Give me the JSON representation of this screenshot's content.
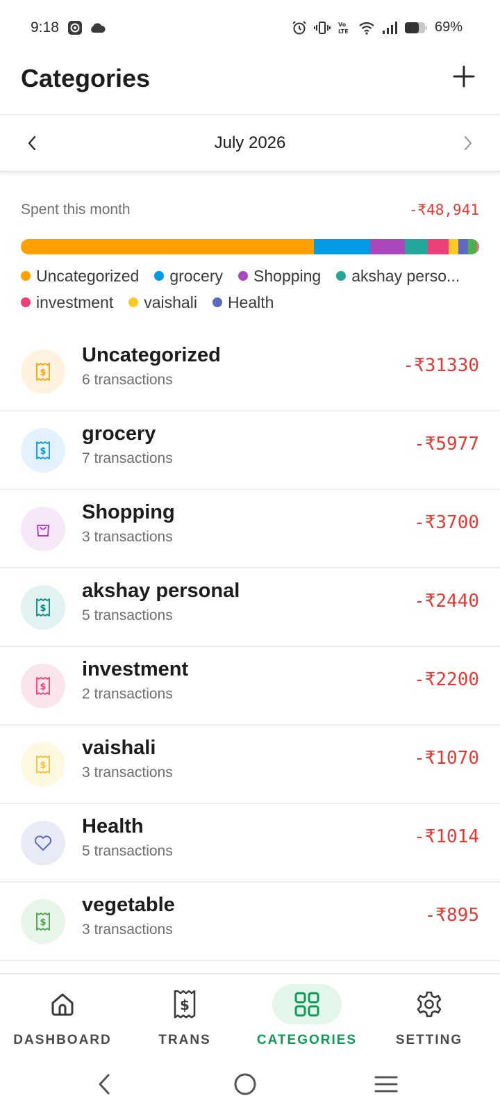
{
  "status_bar": {
    "time": "9:18",
    "battery": "69%"
  },
  "header": {
    "title": "Categories"
  },
  "month_nav": {
    "label": "July 2026"
  },
  "summary": {
    "label": "Spent this month",
    "total": "-₹48,941",
    "segments": [
      {
        "category": "Uncategorized",
        "share": 0.64,
        "color": "#FFA000"
      },
      {
        "category": "grocery",
        "share": 0.122,
        "color": "#039BE5"
      },
      {
        "category": "Shopping",
        "share": 0.076,
        "color": "#AB47BC"
      },
      {
        "category": "akshay personal",
        "share": 0.05,
        "color": "#26A69A"
      },
      {
        "category": "investment",
        "share": 0.045,
        "color": "#EC407A"
      },
      {
        "category": "vaishali",
        "share": 0.022,
        "color": "#FFCA28"
      },
      {
        "category": "Health",
        "share": 0.021,
        "color": "#5C6BC0"
      },
      {
        "category": "vegetable",
        "share": 0.018,
        "color": "#4CAF50"
      },
      {
        "category": "other",
        "share": 0.006,
        "color": "#E57373"
      }
    ]
  },
  "legend": [
    {
      "label": "Uncategorized",
      "color": "#FFA000"
    },
    {
      "label": "grocery",
      "color": "#039BE5"
    },
    {
      "label": "Shopping",
      "color": "#AB47BC"
    },
    {
      "label": "akshay perso...",
      "color": "#26A69A"
    },
    {
      "label": "investment",
      "color": "#EC407A"
    },
    {
      "label": "vaishali",
      "color": "#FFCA28"
    },
    {
      "label": "Health",
      "color": "#5C6BC0"
    }
  ],
  "categories": [
    {
      "name": "Uncategorized",
      "count": "6 transactions",
      "amount": "-₹31330",
      "icon": "receipt-icon",
      "color": "#FFA000",
      "bg": "#FFF3E0"
    },
    {
      "name": "grocery",
      "count": "7 transactions",
      "amount": "-₹5977",
      "icon": "receipt-icon",
      "color": "#039BE5",
      "bg": "#E3F2FD"
    },
    {
      "name": "Shopping",
      "count": "3 transactions",
      "amount": "-₹3700",
      "icon": "shopping-bag-icon",
      "color": "#AB47BC",
      "bg": "#F6E8F8"
    },
    {
      "name": "akshay personal",
      "count": "5 transactions",
      "amount": "-₹2440",
      "icon": "receipt-icon",
      "color": "#00897B",
      "bg": "#E0F2F1"
    },
    {
      "name": "investment",
      "count": "2 transactions",
      "amount": "-₹2200",
      "icon": "receipt-icon",
      "color": "#EC407A",
      "bg": "#FCE4EC"
    },
    {
      "name": "vaishali",
      "count": "3 transactions",
      "amount": "-₹1070",
      "icon": "receipt-icon",
      "color": "#FBC02D",
      "bg": "#FFF8E1"
    },
    {
      "name": "Health",
      "count": "5 transactions",
      "amount": "-₹1014",
      "icon": "heart-icon",
      "color": "#5C6BC0",
      "bg": "#E8EAF6"
    },
    {
      "name": "vegetable",
      "count": "3 transactions",
      "amount": "-₹895",
      "icon": "receipt-icon",
      "color": "#43A047",
      "bg": "#E8F5E9"
    }
  ],
  "bottom_nav": {
    "dashboard": "DASHBOARD",
    "trans": "TRANS",
    "categories": "CATEGORIES",
    "setting": "SETTING",
    "active": "categories",
    "active_color": "#0C9B57"
  }
}
